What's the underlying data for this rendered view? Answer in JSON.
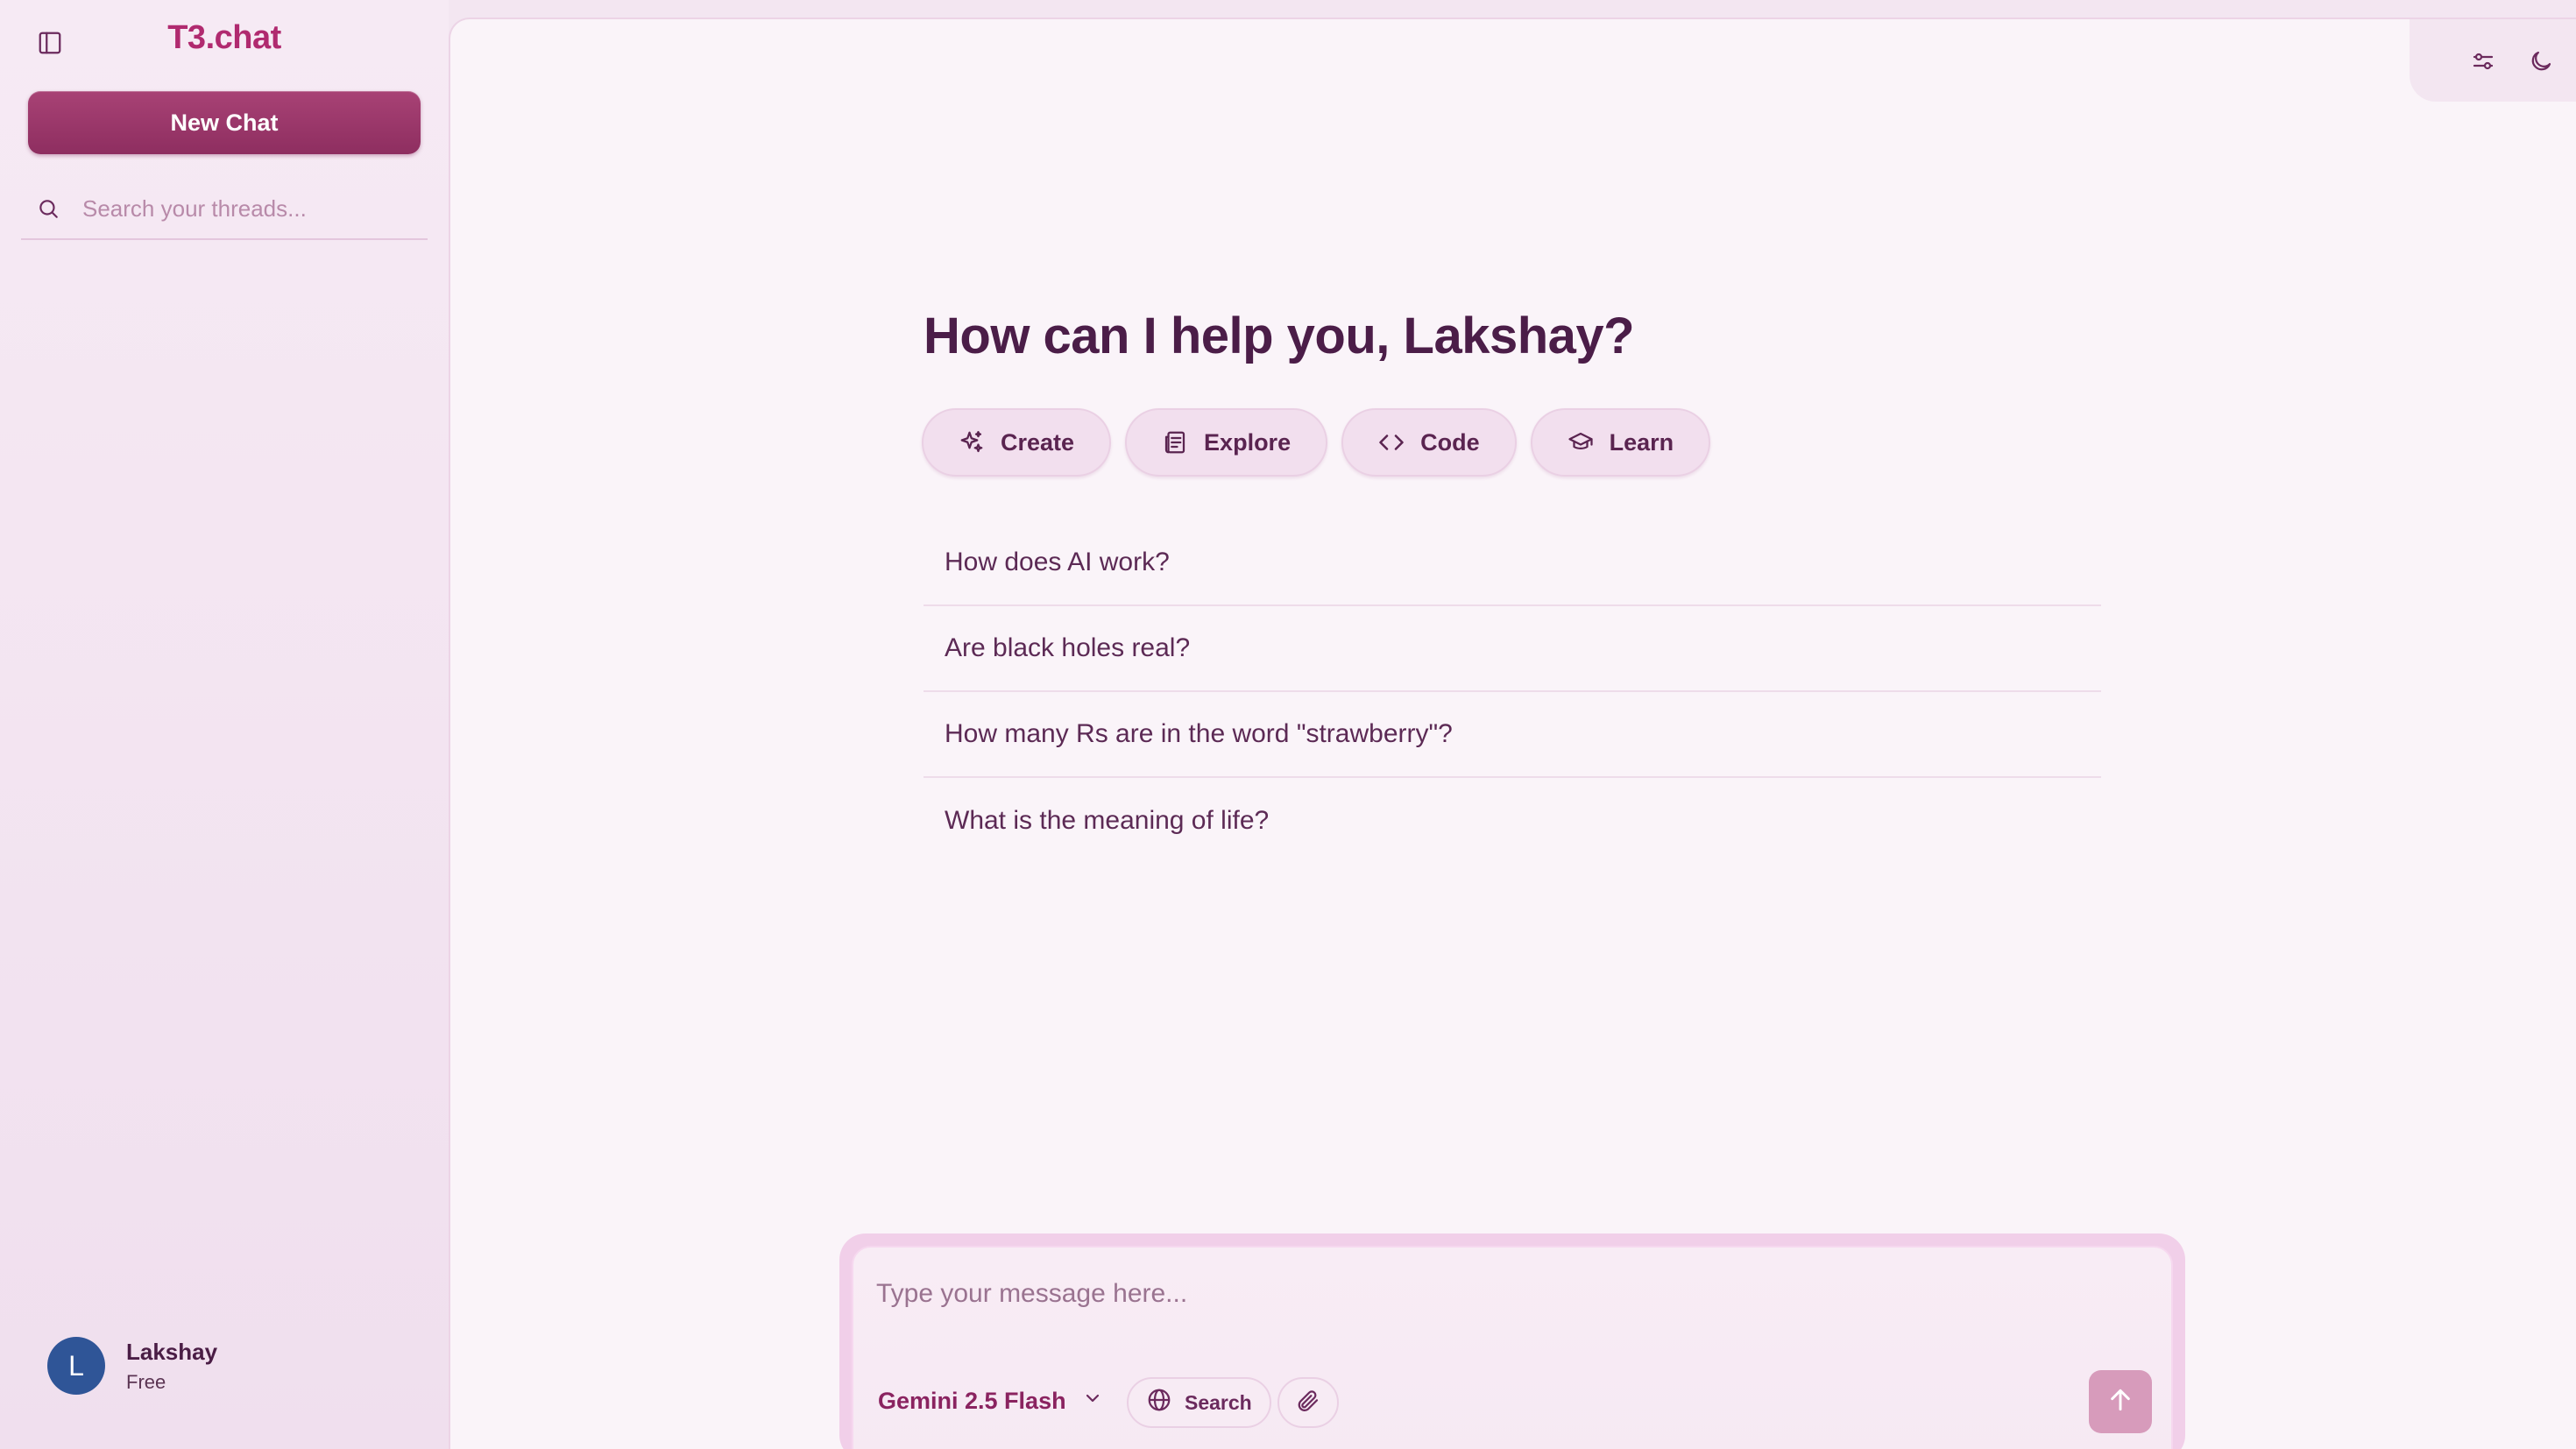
{
  "sidebar": {
    "brand": "T3.chat",
    "new_chat_label": "New Chat",
    "search_placeholder": "Search your threads...",
    "user": {
      "initial": "L",
      "name": "Lakshay",
      "plan": "Free"
    }
  },
  "main": {
    "greeting": "How can I help you, Lakshay?",
    "categories": [
      {
        "label": "Create",
        "icon": "sparkles-icon"
      },
      {
        "label": "Explore",
        "icon": "newspaper-icon"
      },
      {
        "label": "Code",
        "icon": "code-icon"
      },
      {
        "label": "Learn",
        "icon": "graduation-cap-icon"
      }
    ],
    "suggestions": [
      "How does AI work?",
      "Are black holes real?",
      "How many Rs are in the word \"strawberry\"?",
      "What is the meaning of life?"
    ]
  },
  "composer": {
    "placeholder": "Type your message here...",
    "model": "Gemini 2.5 Flash",
    "search_label": "Search"
  },
  "colors": {
    "accent": "#a84275",
    "brand": "#b02a6f",
    "heading": "#4b1d48",
    "avatar": "#2f5597"
  }
}
